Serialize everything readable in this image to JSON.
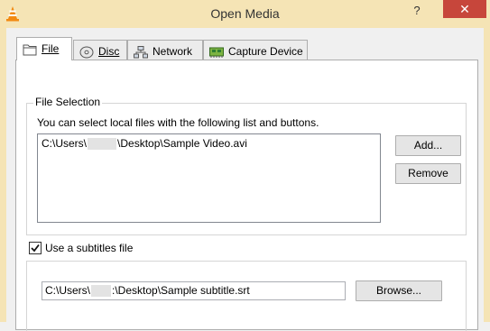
{
  "window": {
    "title": "Open Media",
    "help_label": "?",
    "close_label": "✕",
    "app_icon": "vlc-cone-icon"
  },
  "tabs": [
    {
      "label": "File",
      "icon": "folder-icon",
      "active": true
    },
    {
      "label": "Disc",
      "icon": "disc-icon",
      "active": false
    },
    {
      "label": "Network",
      "icon": "network-icon",
      "active": false
    },
    {
      "label": "Capture Device",
      "icon": "capture-card-icon",
      "active": false
    }
  ],
  "file_selection": {
    "legend": "File Selection",
    "hint": "You can select local files with the following list and buttons.",
    "files": [
      {
        "prefix": "C:\\Users\\",
        "suffix": "\\Desktop\\Sample Video.avi"
      }
    ],
    "add_label": "Add...",
    "remove_label": "Remove"
  },
  "subtitles": {
    "checkbox_label": "Use a subtitles file",
    "checked": true,
    "path_prefix": "C:\\Users\\",
    "path_suffix": ":\\Desktop\\Sample subtitle.srt",
    "browse_label": "Browse..."
  },
  "colors": {
    "titlebar": "#f5e4b5",
    "close_button": "#c7463b",
    "panel": "#ffffff"
  }
}
